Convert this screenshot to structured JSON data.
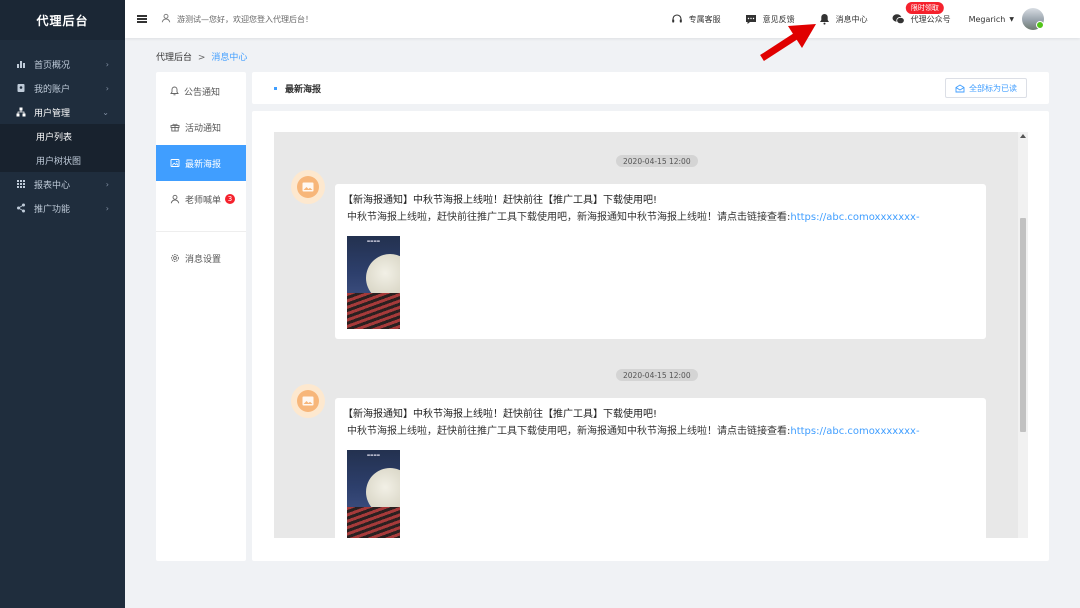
{
  "sidebar": {
    "logo": "代理后台",
    "items": [
      {
        "label": "首页概况",
        "icon": "bar-chart-icon"
      },
      {
        "label": "我的账户",
        "icon": "account-book-icon"
      },
      {
        "label": "用户管理",
        "icon": "org-tree-icon",
        "expanded": true
      },
      {
        "label": "报表中心",
        "icon": "grid-icon"
      },
      {
        "label": "推广功能",
        "icon": "share-icon"
      }
    ],
    "subitems": [
      {
        "label": "用户列表"
      },
      {
        "label": "用户树状图"
      }
    ]
  },
  "header": {
    "welcome": "游测试—您好，欢迎您登入代理后台！",
    "support": "专属客服",
    "feedback": "意见反馈",
    "messages": "消息中心",
    "wechat": "代理公众号",
    "promo_badge": "限时领取",
    "username": "Megarich"
  },
  "breadcrumb": {
    "root": "代理后台",
    "separator": ">",
    "current": "消息中心"
  },
  "msg_nav": {
    "items": [
      {
        "label": "公告通知",
        "icon": "bell-icon"
      },
      {
        "label": "活动通知",
        "icon": "gift-icon"
      },
      {
        "label": "最新海报",
        "icon": "image-icon",
        "active": true
      },
      {
        "label": "老师喊单",
        "icon": "user-icon",
        "badge": "3"
      }
    ],
    "settings": "消息设置"
  },
  "panel": {
    "title": "最新海报",
    "mark_all_read": "全部标为已读"
  },
  "messages": [
    {
      "time": "2020-04-15 12:00",
      "title": "【新海报通知】中秋节海报上线啦！赶快前往【推广工具】下载使用吧!",
      "body": "中秋节海报上线啦，赶快前往推广工具下载使用吧，新海报通知中秋节海报上线啦！请点击链接查看:",
      "link": "https://abc.comoxxxxxxx-"
    },
    {
      "time": "2020-04-15 12:00",
      "title": "【新海报通知】中秋节海报上线啦！赶快前往【推广工具】下载使用吧!",
      "body": "中秋节海报上线啦，赶快前往推广工具下载使用吧，新海报通知中秋节海报上线啦！请点击链接查看:",
      "link": "https://abc.comoxxxxxxx-"
    }
  ],
  "colors": {
    "sidebar_bg": "#1f2d3d",
    "accent": "#409eff",
    "badge": "#f5222d",
    "annotation_arrow": "#e00000"
  }
}
